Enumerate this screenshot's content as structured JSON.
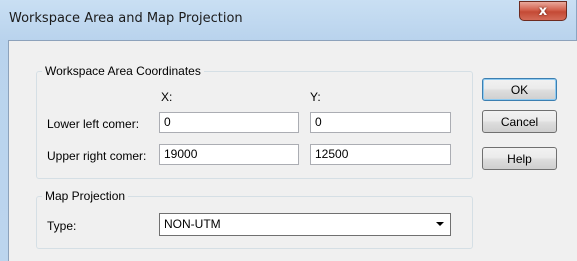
{
  "window": {
    "title": "Workspace Area and Map Projection",
    "close_glyph": "x"
  },
  "coords": {
    "legend": "Workspace Area Coordinates",
    "x_header": "X:",
    "y_header": "Y:",
    "lower_left_label": "Lower left comer:",
    "upper_right_label": "Upper right comer:",
    "lower_left_x": "0",
    "lower_left_y": "0",
    "upper_right_x": "19000",
    "upper_right_y": "12500"
  },
  "projection": {
    "legend": "Map Projection",
    "type_label": "Type:",
    "type_value": "NON-UTM"
  },
  "buttons": {
    "ok": "OK",
    "cancel": "Cancel",
    "help": "Help"
  },
  "icons": {
    "close": "close-icon",
    "dropdown": "chevron-down-icon"
  },
  "colors": {
    "close_button": "#c44a35",
    "title_bar": "#c9dff3",
    "dialog_bg": "#f0f0f0"
  }
}
